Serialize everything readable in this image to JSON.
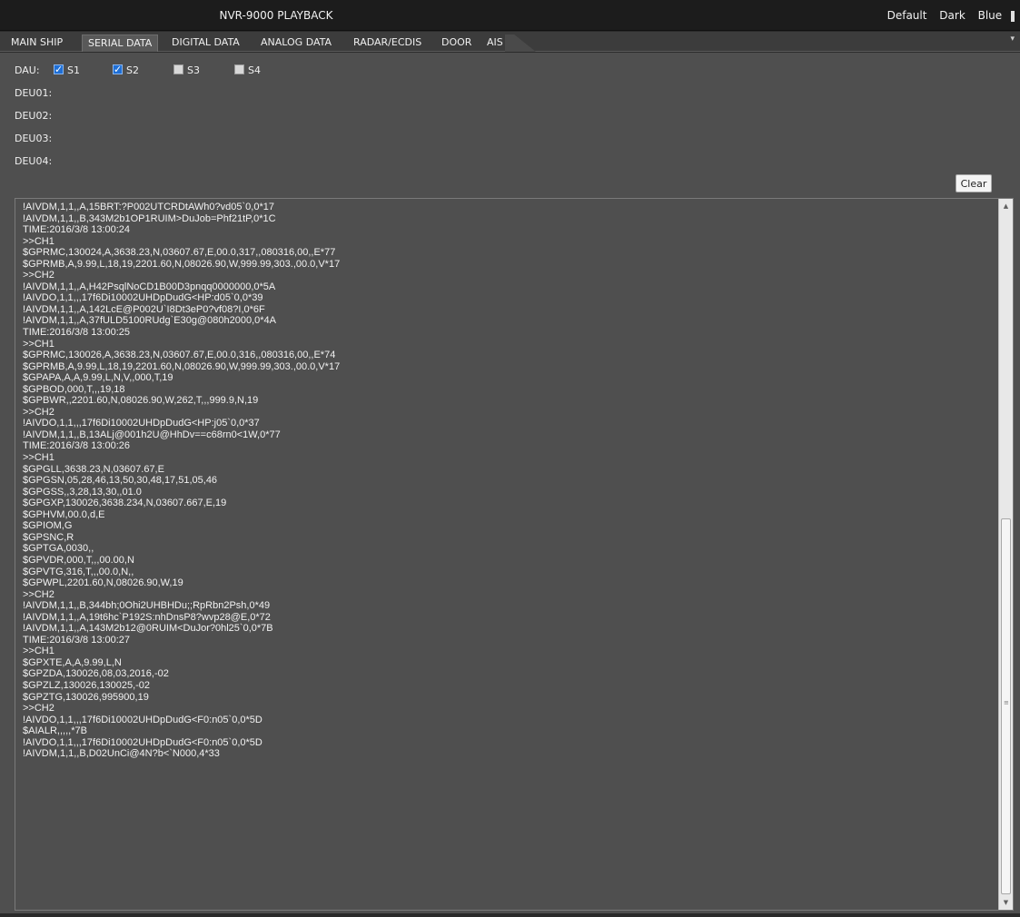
{
  "window": {
    "title": "NVR-9000 PLAYBACK",
    "themes": [
      "Default",
      "Dark",
      "Blue"
    ]
  },
  "tabs": [
    {
      "label": "MAIN SHIP",
      "active": false
    },
    {
      "label": "SERIAL DATA",
      "active": true
    },
    {
      "label": "DIGITAL DATA",
      "active": false
    },
    {
      "label": "ANALOG DATA",
      "active": false
    },
    {
      "label": "RADAR/ECDIS",
      "active": false
    },
    {
      "label": "DOOR",
      "active": false
    },
    {
      "label": "AIS",
      "active": false
    }
  ],
  "tab_pin_icon": "pin-icon",
  "dau": {
    "label": "DAU:",
    "options": [
      {
        "label": "S1",
        "checked": true
      },
      {
        "label": "S2",
        "checked": true
      },
      {
        "label": "S3",
        "checked": false
      },
      {
        "label": "S4",
        "checked": false
      }
    ]
  },
  "deu_labels": [
    "DEU01:",
    "DEU02:",
    "DEU03:",
    "DEU04:"
  ],
  "clear_label": "Clear",
  "log_lines": [
    "!AIVDM,1,1,,A,15BRT:?P002UTCRDtAWh0?vd05`0,0*17",
    "!AIVDM,1,1,,B,343M2b1OP1RUIM>DuJob=Phf21tP,0*1C",
    "TIME:2016/3/8 13:00:24",
    ">>CH1",
    "$GPRMC,130024,A,3638.23,N,03607.67,E,00.0,317,,080316,00,,E*77",
    "$GPRMB,A,9.99,L,18,19,2201.60,N,08026.90,W,999.99,303.,00.0,V*17",
    ">>CH2",
    "!AIVDM,1,1,,A,H42PsqlNoCD1B00D3pnqq0000000,0*5A",
    "!AIVDO,1,1,,,17f6Di10002UHDpDudG<HP:d05`0,0*39",
    "!AIVDM,1,1,,A,142LcE@P002U`I8Dt3eP0?vf08?I,0*6F",
    "!AIVDM,1,1,,A,37fULD5100RUdg`E30g@080h2000,0*4A",
    "TIME:2016/3/8 13:00:25",
    ">>CH1",
    "$GPRMC,130026,A,3638.23,N,03607.67,E,00.0,316,,080316,00,,E*74",
    "$GPRMB,A,9.99,L,18,19,2201.60,N,08026.90,W,999.99,303.,00.0,V*17",
    "$GPAPA,A,A,9.99,L,N,V,,000,T,19",
    "$GPBOD,000,T,,,19,18",
    "$GPBWR,,2201.60,N,08026.90,W,262,T,,,999.9,N,19",
    ">>CH2",
    "!AIVDO,1,1,,,17f6Di10002UHDpDudG<HP:j05`0,0*37",
    "!AIVDM,1,1,,B,13ALj@001h2U@HhDv==c68rn0<1W,0*77",
    "TIME:2016/3/8 13:00:26",
    ">>CH1",
    "$GPGLL,3638.23,N,03607.67,E",
    "$GPGSN,05,28,46,13,50,30,48,17,51,05,46",
    "$GPGSS,,3,28,13,30,,01.0",
    "$GPGXP,130026,3638.234,N,03607.667,E,19",
    "$GPHVM,00.0,d,E",
    "$GPIOM,G",
    "$GPSNC,R",
    "$GPTGA,0030,,",
    "$GPVDR,000,T,,,00.00,N",
    "$GPVTG,316,T,,,00.0,N,,",
    "$GPWPL,2201.60,N,08026.90,W,19",
    ">>CH2",
    "!AIVDM,1,1,,B,344bh;0Ohi2UHBHDu;;RpRbn2Psh,0*49",
    "!AIVDM,1,1,,A,19t6hc`P192S:nhDnsP8?wvp28@E,0*72",
    "!AIVDM,1,1,,A,143M2b12@0RUIM<DuJor?0hl25`0,0*7B",
    "TIME:2016/3/8 13:00:27",
    ">>CH1",
    "$GPXTE,A,A,9.99,L,N",
    "$GPZDA,130026,08,03,2016,-02",
    "$GPZLZ,130026,130025,-02",
    "$GPZTG,130026,995900,19",
    ">>CH2",
    "!AIVDO,1,1,,,17f6Di10002UHDpDudG<F0:n05`0,0*5D",
    "$AIALR,,,,,*7B",
    "!AIVDO,1,1,,,17f6Di10002UHDpDudG<F0:n05`0,0*5D",
    "!AIVDM,1,1,,B,D02UnCi@4N?b<`N000,4*33"
  ]
}
